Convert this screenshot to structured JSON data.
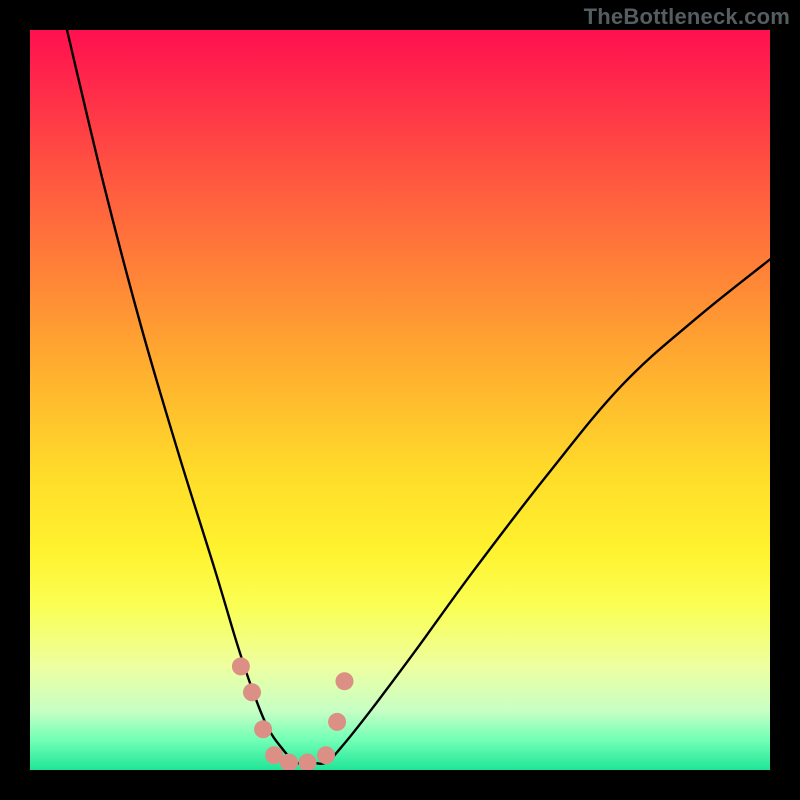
{
  "watermark": "TheBottleneck.com",
  "chart_data": {
    "type": "line",
    "title": "",
    "xlabel": "",
    "ylabel": "",
    "xlim": [
      0,
      100
    ],
    "ylim": [
      0,
      100
    ],
    "series": [
      {
        "name": "bottleneck-curve",
        "x": [
          5,
          10,
          15,
          20,
          25,
          28,
          30,
          32,
          34,
          36,
          38,
          40,
          42,
          46,
          52,
          60,
          70,
          80,
          90,
          100
        ],
        "values": [
          100,
          79,
          60,
          43,
          27,
          17,
          11,
          6,
          3,
          1,
          1,
          1,
          3,
          8,
          16,
          27,
          40,
          52,
          61,
          69
        ]
      }
    ],
    "markers": {
      "name": "highlight-dots",
      "x": [
        28.5,
        30.0,
        31.5,
        33.0,
        35.0,
        37.5,
        40.0,
        41.5,
        42.5
      ],
      "values": [
        14.0,
        10.5,
        5.5,
        2.0,
        1.0,
        1.0,
        2.0,
        6.5,
        12.0
      ],
      "color": "#db8f85",
      "radius": 9
    },
    "background_gradient": {
      "top": "#ff104f",
      "bottom": "#20e598"
    }
  }
}
